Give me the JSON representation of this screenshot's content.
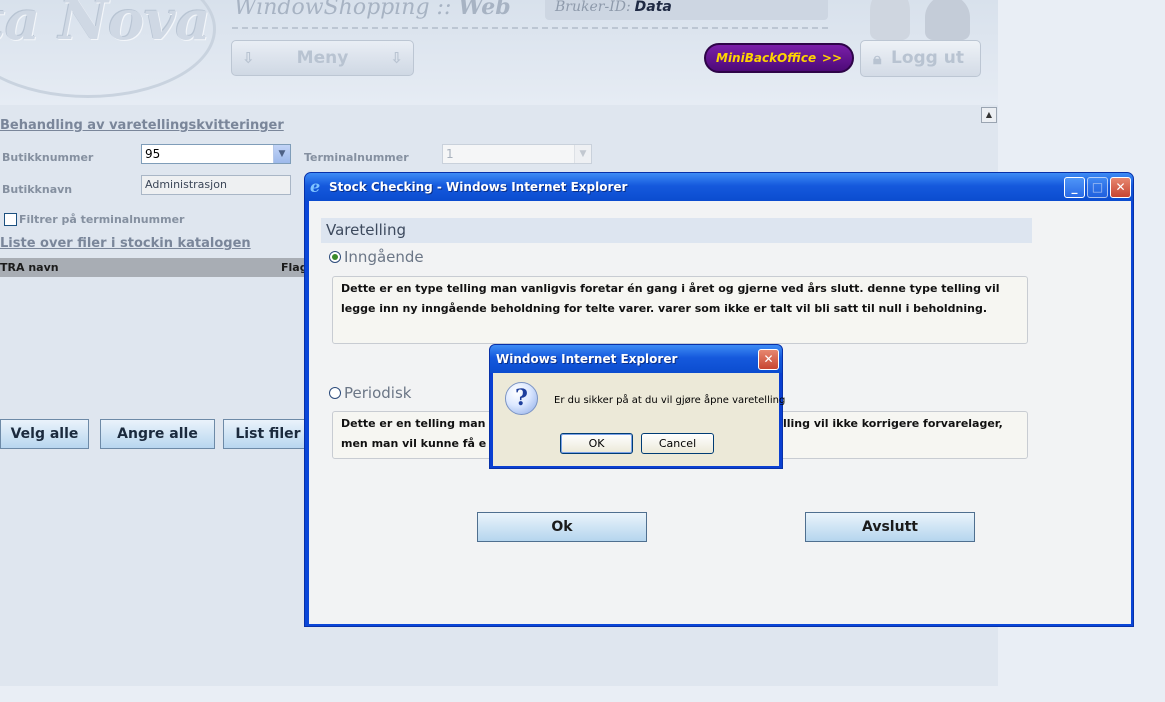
{
  "header": {
    "logo_text": "ta Nova",
    "app_title_pre": "Window",
    "app_title_s": "S",
    "app_title_rest": "hopping",
    "app_title_sep": "::",
    "app_title_web": "Web",
    "user_label": "Bruker-ID:",
    "user_value": "Data",
    "menu_label": "Meny",
    "minibackoffice_label": "MiniBackOffice",
    "minibackoffice_arrow": ">>",
    "logout_label": "Logg ut"
  },
  "page": {
    "heading": "Behandling av varetellingskvitteringer",
    "butikknummer_label": "Butikknummer",
    "butikknummer_value": "95",
    "terminalnummer_label": "Terminalnummer",
    "terminalnummer_value": "1",
    "butikknavn_label": "Butikknavn",
    "butikknavn_value": "Administrasjon",
    "filter_label": "Filtrer på terminalnummer",
    "list_link": "Liste over filer i stockin katalogen",
    "table_col1": "TRA navn",
    "table_col2": "Flag",
    "btn_select_all": "Velg alle",
    "btn_undo_all": "Angre alle",
    "btn_list_files": "List filer"
  },
  "ie_window": {
    "title": "Stock Checking - Windows Internet Explorer",
    "section_title": "Varetelling",
    "option1_label": "Inngående",
    "option1_desc": "Dette er en type telling man vanligvis foretar én gang i året og gjerne ved års slutt. denne type telling vil legge inn ny inngående beholdning for telte varer. varer som ikke er talt vil bli satt til null i beholdning.",
    "option2_label": "Periodisk",
    "option2_desc_left": "Dette er en telling man",
    "option2_desc_right": "lling vil ikke korrigere forvarelager,",
    "option2_desc_line2": "men man vil kunne få e",
    "ok_label": "Ok",
    "exit_label": "Avslutt"
  },
  "dialog": {
    "title": "Windows Internet Explorer",
    "message": "Er du sikker på at du vil gjøre åpne varetelling",
    "ok_label": "OK",
    "cancel_label": "Cancel"
  }
}
